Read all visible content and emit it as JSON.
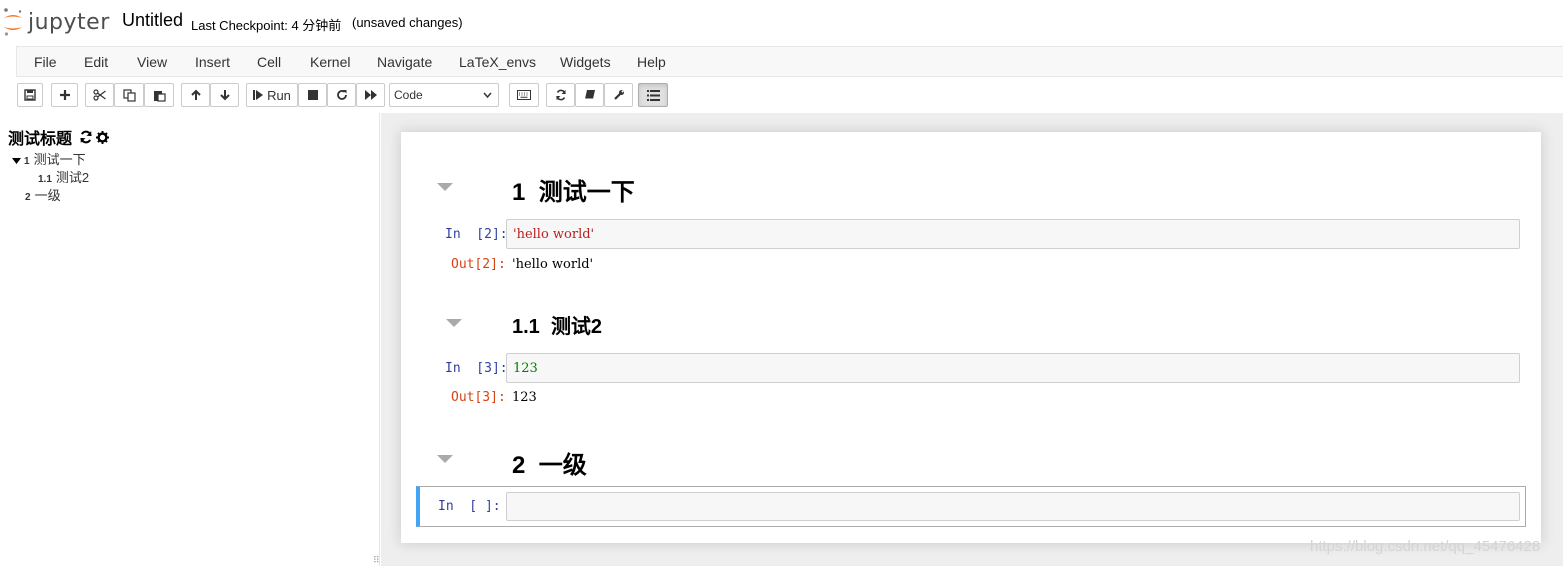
{
  "header": {
    "logo_text": "jupyter",
    "notebook_name": "Untitled",
    "checkpoint": "Last Checkpoint: 4 分钟前",
    "autosave_status": "(unsaved changes)"
  },
  "menu": [
    "File",
    "Edit",
    "View",
    "Insert",
    "Cell",
    "Kernel",
    "Navigate",
    "LaTeX_envs",
    "Widgets",
    "Help"
  ],
  "toolbar": {
    "run_label": "Run",
    "cell_type": "Code"
  },
  "toc": {
    "title": "测试标题",
    "items": [
      {
        "num": "1",
        "label": "测试一下"
      },
      {
        "num": "1.1",
        "label": "测试2"
      },
      {
        "num": "2",
        "label": "一级"
      }
    ]
  },
  "cells": {
    "h1_num": "1",
    "h1_title": "测试一下",
    "c1_in_prompt": "In  [2]:",
    "c1_code": "'hello world'",
    "c1_out_prompt": "Out[2]:",
    "c1_output": "'hello world'",
    "h2_num": "1.1",
    "h2_title": "测试2",
    "c2_in_prompt": "In  [3]:",
    "c2_code": "123",
    "c2_out_prompt": "Out[3]:",
    "c2_output": "123",
    "h3_num": "2",
    "h3_title": "一级",
    "c3_in_prompt": "In  [ ]:"
  },
  "colors": {
    "code_string": "#ba2121",
    "code_number": "#008000",
    "prompt_in": "#303f9f",
    "prompt_out": "#d84315",
    "selected_cell_bar": "#42a5f5"
  },
  "watermark": "https://blog.csdn.net/qq_45476428"
}
